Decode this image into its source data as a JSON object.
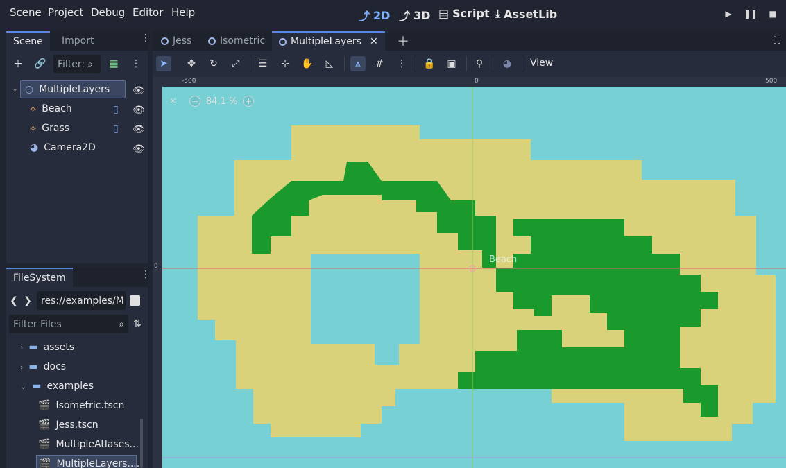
{
  "menu": [
    "Scene",
    "Project",
    "Debug",
    "Editor",
    "Help"
  ],
  "workspaces": [
    {
      "label": "2D",
      "icon": "2d-icon",
      "active": true
    },
    {
      "label": "3D",
      "icon": "3d-icon",
      "active": false
    },
    {
      "label": "Script",
      "icon": "script-icon",
      "active": false
    },
    {
      "label": "AssetLib",
      "icon": "assetlib-icon",
      "active": false
    }
  ],
  "scene_dock": {
    "tabs": [
      "Scene",
      "Import"
    ],
    "filter_placeholder": "Filter:",
    "tree": [
      {
        "label": "MultipleLayers",
        "icon": "node2d-icon",
        "selected": true
      },
      {
        "label": "Beach",
        "icon": "tilemap-icon"
      },
      {
        "label": "Grass",
        "icon": "tilemap-icon"
      },
      {
        "label": "Camera2D",
        "icon": "camera2d-icon"
      }
    ]
  },
  "filesystem": {
    "tab": "FileSystem",
    "path": "res://examples/M",
    "filter_placeholder": "Filter Files",
    "items": [
      {
        "label": "assets",
        "type": "folder",
        "expanded": false
      },
      {
        "label": "docs",
        "type": "folder",
        "expanded": false
      },
      {
        "label": "examples",
        "type": "folder",
        "expanded": true
      },
      {
        "label": "Isometric.tscn",
        "type": "scene"
      },
      {
        "label": "Jess.tscn",
        "type": "scene"
      },
      {
        "label": "MultipleAtlases...",
        "type": "scene"
      },
      {
        "label": "MultipleLayers....",
        "type": "scene",
        "selected": true
      }
    ]
  },
  "scene_tabs": [
    {
      "label": "Jess",
      "active": false
    },
    {
      "label": "Isometric",
      "active": false
    },
    {
      "label": "MultipleLayers",
      "active": true
    }
  ],
  "toolbar": {
    "view_label": "View"
  },
  "viewport": {
    "zoom": "84.1 %",
    "ruler": [
      "-500",
      "0",
      "500"
    ],
    "ruler_left_zero": "0",
    "node_label": "Beach"
  },
  "colors": {
    "water": "#76d0d4",
    "sand": "#d9d27a",
    "grass": "#1a9a2c",
    "accent": "#7fb0ff"
  }
}
